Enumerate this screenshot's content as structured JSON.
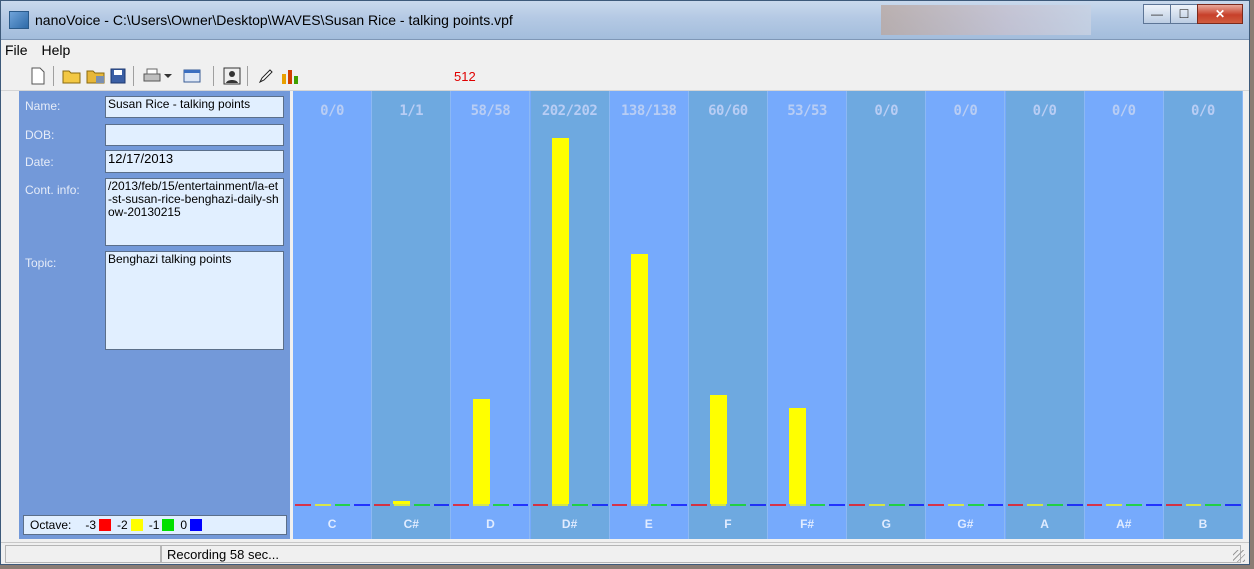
{
  "window": {
    "title": "nanoVoice - C:\\Users\\Owner\\Desktop\\WAVES\\Susan Rice - talking points.vpf",
    "buttons": {
      "minimize": "—",
      "maximize": "☐",
      "close": "✕"
    }
  },
  "menu": {
    "items": [
      "File",
      "Help"
    ]
  },
  "toolbar": {
    "icons": [
      "new-file-icon",
      "open-folder-icon",
      "open-recent-icon",
      "save-icon",
      "print-icon",
      "dropdown-arrow-icon",
      "window-icon",
      "profile-icon",
      "edit-pen-icon",
      "bar-chart-icon"
    ],
    "sample_count": "512"
  },
  "form": {
    "name_label": "Name:",
    "name_value": "Susan Rice - talking points",
    "dob_label": "DOB:",
    "dob_value": "",
    "date_label": "Date:",
    "date_value": "12/17/2013",
    "contact_label": "Cont. info:",
    "contact_value": "/2013/feb/15/entertainment/la-et-st-susan-rice-benghazi-daily-show-20130215",
    "topic_label": "Topic:",
    "topic_value": "Benghazi talking points"
  },
  "octave": {
    "label": "Octave:",
    "items": [
      {
        "label": "-3",
        "color": "#ff0000"
      },
      {
        "label": "-2",
        "color": "#ffff00"
      },
      {
        "label": "-1",
        "color": "#00e000"
      },
      {
        "label": "0",
        "color": "#0000ff"
      }
    ]
  },
  "status": {
    "text": "Recording 58 sec..."
  },
  "chart_data": {
    "type": "bar",
    "categories": [
      "C",
      "C#",
      "D",
      "D#",
      "E",
      "F",
      "F#",
      "G",
      "G#",
      "A",
      "A#",
      "B"
    ],
    "counts": [
      "0/0",
      "1/1",
      "58/58",
      "202/202",
      "138/138",
      "60/60",
      "53/53",
      "0/0",
      "0/0",
      "0/0",
      "0/0",
      "0/0"
    ],
    "series": [
      {
        "name": "-3",
        "color": "#ff0000",
        "values": [
          0,
          0,
          0,
          0,
          0,
          0,
          0,
          0,
          0,
          0,
          0,
          0
        ]
      },
      {
        "name": "-2",
        "color": "#ffff00",
        "values": [
          0,
          1,
          58,
          202,
          138,
          60,
          53,
          0,
          0,
          0,
          0,
          0
        ]
      },
      {
        "name": "-1",
        "color": "#00e000",
        "values": [
          0,
          0,
          0,
          0,
          0,
          0,
          0,
          0,
          0,
          0,
          0,
          0
        ]
      },
      {
        "name": "0",
        "color": "#0000ff",
        "values": [
          0,
          0,
          0,
          0,
          0,
          0,
          0,
          0,
          0,
          0,
          0,
          0
        ]
      }
    ],
    "ylim": [
      0,
      202
    ],
    "grid": false
  }
}
